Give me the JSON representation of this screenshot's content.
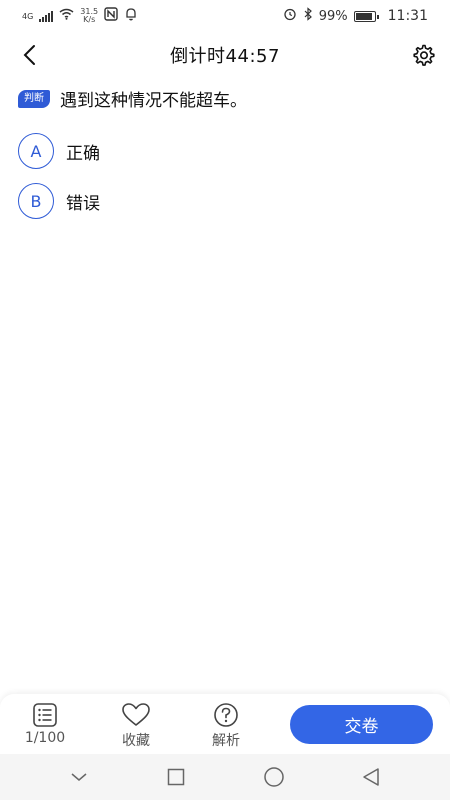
{
  "status_bar": {
    "network": "4G",
    "speed_value": "31.5",
    "speed_unit": "K/s",
    "battery": "99%",
    "time": "11:31"
  },
  "header": {
    "title": "倒计时44:57"
  },
  "question": {
    "type_label": "判断",
    "text": "遇到这种情况不能超车。",
    "options": [
      {
        "letter": "A",
        "text": "正确"
      },
      {
        "letter": "B",
        "text": "错误"
      }
    ]
  },
  "bottom_bar": {
    "progress_label": "1/100",
    "favorite_label": "收藏",
    "analysis_label": "解析",
    "submit_label": "交卷"
  },
  "colors": {
    "accent": "#3366e6",
    "badge": "#2f5bd6"
  }
}
